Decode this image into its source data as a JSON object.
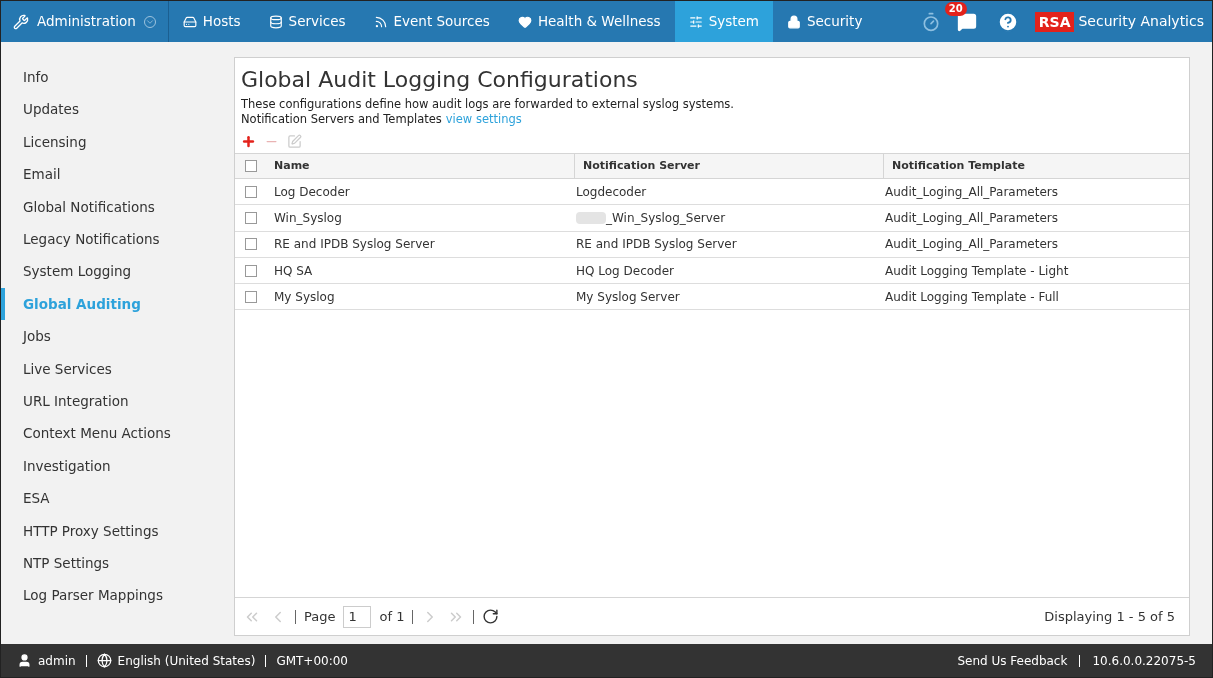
{
  "nav": {
    "admin": "Administration",
    "tabs": [
      {
        "label": "Hosts",
        "kind": "hosts",
        "selected": false
      },
      {
        "label": "Services",
        "kind": "services",
        "selected": false
      },
      {
        "label": "Event Sources",
        "kind": "rss",
        "selected": false
      },
      {
        "label": "Health & Wellness",
        "kind": "heart",
        "selected": false
      },
      {
        "label": "System",
        "kind": "sliders",
        "selected": true
      },
      {
        "label": "Security",
        "kind": "lock",
        "selected": false
      }
    ],
    "notifications": "20",
    "brand_logo": "RSA",
    "brand": "Security Analytics"
  },
  "sidebar": {
    "items": [
      {
        "label": "Info",
        "selected": false
      },
      {
        "label": "Updates",
        "selected": false
      },
      {
        "label": "Licensing",
        "selected": false
      },
      {
        "label": "Email",
        "selected": false
      },
      {
        "label": "Global Notifications",
        "selected": false
      },
      {
        "label": "Legacy Notifications",
        "selected": false
      },
      {
        "label": "System Logging",
        "selected": false
      },
      {
        "label": "Global Auditing",
        "selected": true
      },
      {
        "label": "Jobs",
        "selected": false
      },
      {
        "label": "Live Services",
        "selected": false
      },
      {
        "label": "URL Integration",
        "selected": false
      },
      {
        "label": "Context Menu Actions",
        "selected": false
      },
      {
        "label": "Investigation",
        "selected": false
      },
      {
        "label": "ESA",
        "selected": false
      },
      {
        "label": "HTTP Proxy Settings",
        "selected": false
      },
      {
        "label": "NTP Settings",
        "selected": false
      },
      {
        "label": "Log Parser Mappings",
        "selected": false
      }
    ]
  },
  "panel": {
    "title": "Global Audit Logging Configurations",
    "description": "These configurations define how audit logs are forwarded to external syslog systems.",
    "settings_text": "Notification Servers and Templates",
    "settings_link": "view settings",
    "toolbar": [
      {
        "kind": "add",
        "disabled": false
      },
      {
        "kind": "remove",
        "disabled": true
      },
      {
        "kind": "edit",
        "disabled": true
      }
    ],
    "table": {
      "all_checked": false,
      "columns": [
        "Name",
        "Notification Server",
        "Notification Template"
      ],
      "rows": [
        {
          "checked": false,
          "cells": [
            "Log Decoder",
            "Logdecoder",
            "Audit_Loging_All_Parameters"
          ],
          "redacted": false
        },
        {
          "checked": false,
          "cells": [
            "Win_Syslog",
            "_Win_Syslog_Server",
            "Audit_Loging_All_Parameters"
          ],
          "redacted": true
        },
        {
          "checked": false,
          "cells": [
            "RE and IPDB Syslog Server",
            "RE and IPDB Syslog Server",
            "Audit_Loging_All_Parameters"
          ],
          "redacted": false
        },
        {
          "checked": false,
          "cells": [
            "HQ SA",
            "HQ Log Decoder",
            "Audit Logging Template - Light"
          ],
          "redacted": false
        },
        {
          "checked": false,
          "cells": [
            "My Syslog",
            "My Syslog Server",
            "Audit Logging Template - Full"
          ],
          "redacted": false
        }
      ]
    },
    "pager": {
      "page_label": "Page",
      "page": "1",
      "of": "of 1",
      "display": "Displaying 1 - 5 of 5"
    }
  },
  "status_bar": {
    "user": "admin",
    "language": "English (United States)",
    "timezone": "GMT+00:00",
    "feedback": "Send Us Feedback",
    "version": "10.6.0.0.22075-5"
  }
}
